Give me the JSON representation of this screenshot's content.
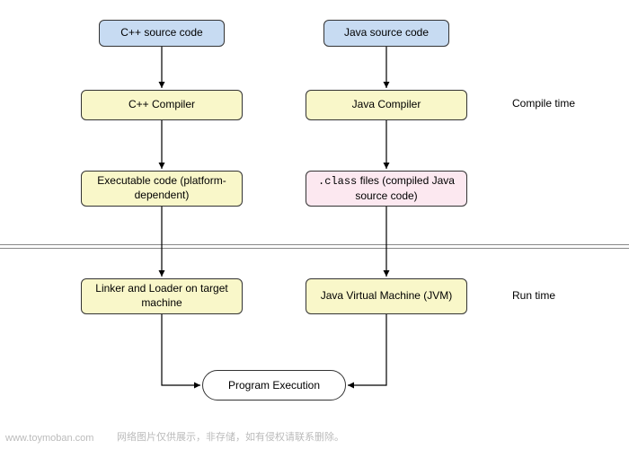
{
  "nodes": {
    "cpp_source": {
      "text": "C++ source code"
    },
    "java_source": {
      "text": "Java source code"
    },
    "cpp_compiler": {
      "text": "C++ Compiler"
    },
    "java_compiler": {
      "text": "Java Compiler"
    },
    "exe_code": {
      "text": "Executable code (platform-dependent)"
    },
    "class_files": {
      "prefix": ".class",
      "suffix": " files (compiled Java source code)"
    },
    "linker": {
      "text": "Linker and Loader on target machine"
    },
    "jvm": {
      "text": "Java Virtual Machine (JVM)"
    },
    "program_exec": {
      "text": "Program Execution"
    }
  },
  "labels": {
    "compile_time": "Compile time",
    "run_time": "Run time"
  },
  "watermark": {
    "site": "www.toymoban.com",
    "note": "网络图片仅供展示，非存储，如有侵权请联系删除。"
  }
}
